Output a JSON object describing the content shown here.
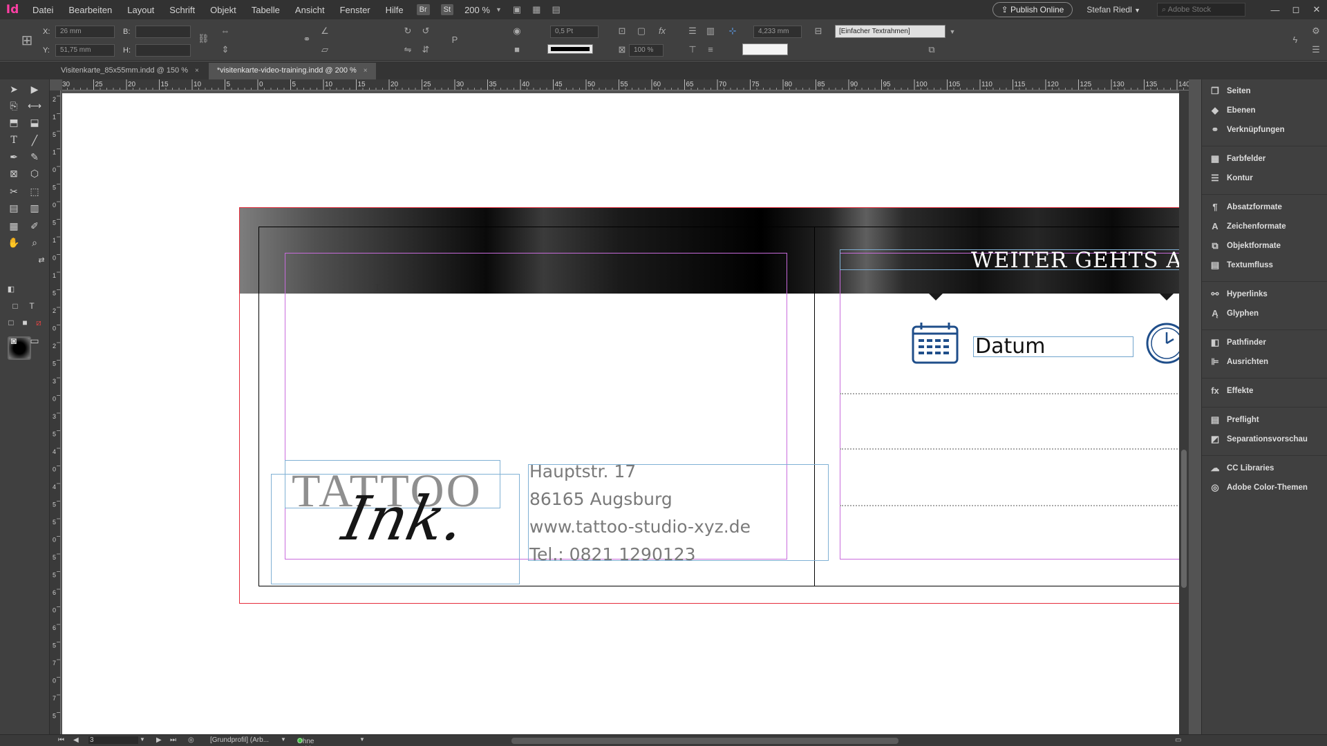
{
  "app": {
    "logo": "Id",
    "menu": [
      "Datei",
      "Bearbeiten",
      "Layout",
      "Schrift",
      "Objekt",
      "Tabelle",
      "Ansicht",
      "Fenster",
      "Hilfe"
    ],
    "bridge_badge": "Br",
    "stock_badge": "St",
    "zoom": "200 %",
    "publish_label": "Publish Online",
    "user_name": "Stefan Riedl",
    "stock_search_placeholder": "Adobe Stock",
    "window_controls": [
      "—",
      "◻",
      "✕"
    ]
  },
  "control_panel": {
    "x_label": "X:",
    "x_value": "26 mm",
    "y_label": "Y:",
    "y_value": "51,75 mm",
    "w_label": "B:",
    "h_label": "H:",
    "stroke_weight": "0,5 Pt",
    "scale_value": "100 %",
    "offset_value": "4,233 mm",
    "object_style": "[Einfacher Textrahmen]"
  },
  "tabs": [
    {
      "label": "Visitenkarte_85x55mm.indd @ 150 %",
      "close": "×",
      "active": false
    },
    {
      "label": "*visitenkarte-video-training.indd @ 200 %",
      "close": "×",
      "active": true
    }
  ],
  "ruler": {
    "h_labels": [
      "30",
      "25",
      "20",
      "15",
      "10",
      "5",
      "0",
      "5",
      "10",
      "15",
      "20",
      "25",
      "30",
      "35",
      "40",
      "45",
      "50",
      "55",
      "60",
      "65",
      "70",
      "75",
      "80",
      "85",
      "90",
      "95",
      "100",
      "105",
      "110",
      "115",
      "120",
      "125",
      "130",
      "135",
      "140"
    ],
    "v_labels": [
      "2",
      "1",
      "5",
      "1",
      "0",
      "5",
      "0",
      "5",
      "1",
      "0",
      "1",
      "5",
      "2",
      "0",
      "2",
      "5",
      "3",
      "0",
      "3",
      "5",
      "4",
      "0",
      "4",
      "5",
      "5",
      "0",
      "5",
      "5",
      "6",
      "0",
      "6",
      "5",
      "7",
      "0",
      "7",
      "5"
    ]
  },
  "document": {
    "address_lines": [
      "Hauptstr. 17",
      "86165 Augsburg",
      "www.tattoo-studio-xyz.de",
      "Tel.: 0821 1290123"
    ],
    "logo_word": "TATTOO",
    "logo_script": "Ink.",
    "headline": "WEITER GEHTS A",
    "date_field": "Datum"
  },
  "panels": [
    {
      "label": "Seiten",
      "icon": "pages-icon"
    },
    {
      "label": "Ebenen",
      "icon": "layers-icon"
    },
    {
      "label": "Verknüpfungen",
      "icon": "links-icon"
    },
    {
      "label": "Farbfelder",
      "icon": "swatches-icon"
    },
    {
      "label": "Kontur",
      "icon": "stroke-icon"
    },
    {
      "label": "Absatzformate",
      "icon": "paragraph-styles-icon"
    },
    {
      "label": "Zeichenformate",
      "icon": "character-styles-icon"
    },
    {
      "label": "Objektformate",
      "icon": "object-styles-icon"
    },
    {
      "label": "Textumfluss",
      "icon": "text-wrap-icon"
    },
    {
      "label": "Hyperlinks",
      "icon": "hyperlinks-icon"
    },
    {
      "label": "Glyphen",
      "icon": "glyphs-icon"
    },
    {
      "label": "Pathfinder",
      "icon": "pathfinder-icon"
    },
    {
      "label": "Ausrichten",
      "icon": "align-icon"
    },
    {
      "label": "Effekte",
      "icon": "effects-icon"
    },
    {
      "label": "Preflight",
      "icon": "preflight-icon"
    },
    {
      "label": "Separationsvorschau",
      "icon": "separations-icon"
    },
    {
      "label": "CC Libraries",
      "icon": "cc-libraries-icon"
    },
    {
      "label": "Adobe Color-Themen",
      "icon": "color-themes-icon"
    }
  ],
  "status": {
    "page": "3",
    "profile": "[Grundprofil] (Arb...",
    "preflight": "Ohne Fehler"
  },
  "colors": {
    "accent": "#ff3fa4",
    "bleed": "#e52b3a",
    "margin": "#c86bdc",
    "frame": "#7fb0d4",
    "icon_blue": "#1f4e8a",
    "ok": "#3ec43e"
  }
}
